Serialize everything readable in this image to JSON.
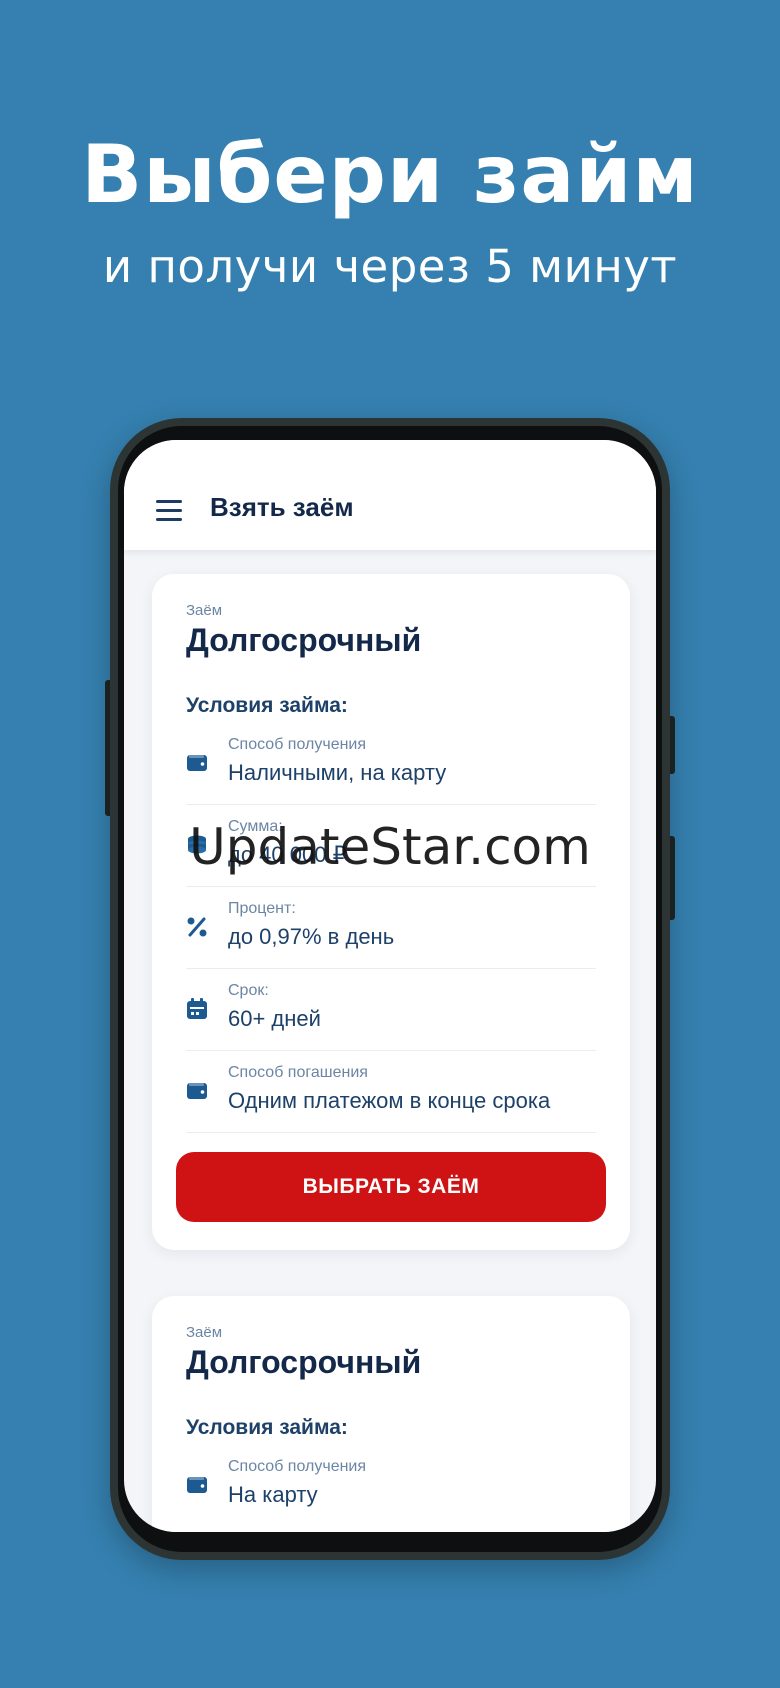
{
  "promo": {
    "headline": "Выбери займ",
    "subline": "и получи через 5 минут"
  },
  "appbar": {
    "title": "Взять заём",
    "menu_icon": "hamburger-menu-icon"
  },
  "cards": [
    {
      "kicker": "Заём",
      "title": "Долгосрочный",
      "section": "Условия займа:",
      "rows": [
        {
          "icon": "wallet-icon",
          "label": "Способ получения",
          "value": "Наличными, на карту"
        },
        {
          "icon": "coins-icon",
          "label": "Сумма:",
          "value": "до 40 000 ₽"
        },
        {
          "icon": "percent-icon",
          "label": "Процент:",
          "value": "до 0,97% в день"
        },
        {
          "icon": "calendar-icon",
          "label": "Срок:",
          "value": "60+ дней"
        },
        {
          "icon": "wallet-icon",
          "label": "Способ погашения",
          "value": "Одним платежом в конце срока"
        }
      ],
      "button": "ВЫБРАТЬ ЗАЁМ"
    },
    {
      "kicker": "Заём",
      "title": "Долгосрочный",
      "section": "Условия займа:",
      "rows": [
        {
          "icon": "wallet-icon",
          "label": "Способ получения",
          "value": "На карту"
        }
      ]
    }
  ],
  "watermark": "UpdateStar.com",
  "colors": {
    "background": "#3580b0",
    "accent_button": "#cf1214",
    "text_dark": "#14294a",
    "icon_blue": "#1d5a92"
  }
}
